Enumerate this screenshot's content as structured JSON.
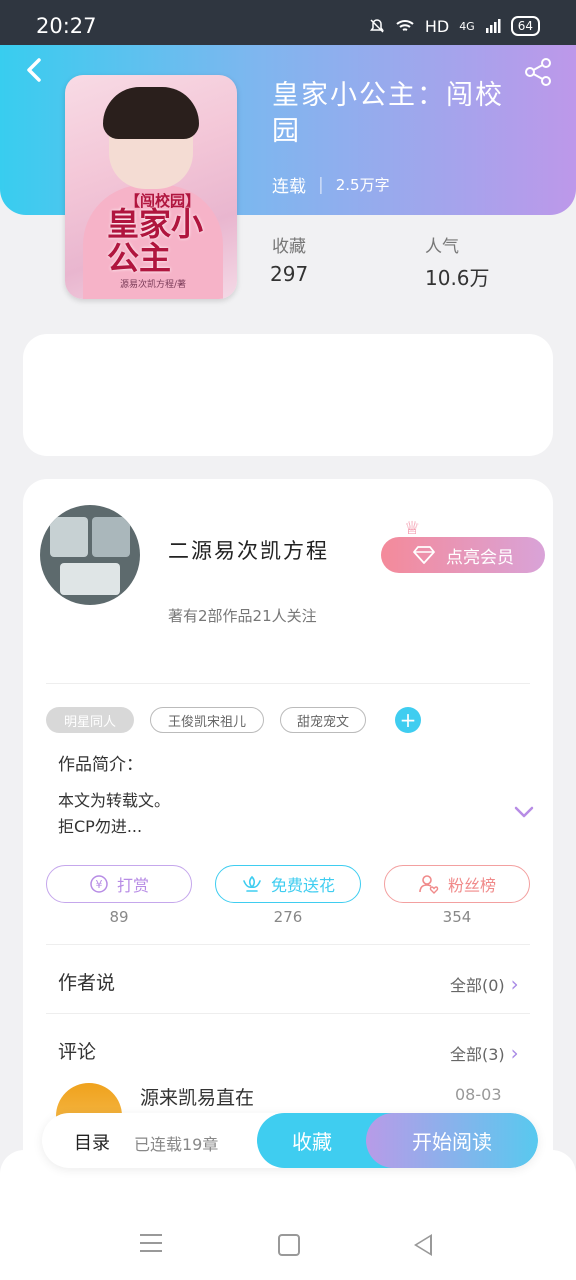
{
  "status_bar": {
    "time": "20:27",
    "network": "HD",
    "signal": "4G",
    "battery": "64"
  },
  "book": {
    "title": "皇家小公主：闯校园",
    "status": "连载",
    "word_count": "2.5万字",
    "cover": {
      "small_title": "【闯校园】",
      "big_title": "皇家小公主",
      "author": "源易次凯方程/著"
    }
  },
  "stats": [
    {
      "label": "收藏",
      "value": "297"
    },
    {
      "label": "人气",
      "value": "10.6万"
    }
  ],
  "author": {
    "name": "二源易次凯方程",
    "subtitle": "著有2部作品21人关注",
    "vip_button": "点亮会员"
  },
  "tags": [
    "明星同人",
    "王俊凯宋祖儿",
    "甜宠宠文"
  ],
  "intro": {
    "label": "作品简介：",
    "line1": "本文为转载文。",
    "line2": "拒CP勿进..."
  },
  "actions": [
    {
      "label": "打赏",
      "count": "89",
      "icon": "yen-icon",
      "color": "#b78ce5"
    },
    {
      "label": "免费送花",
      "count": "276",
      "icon": "flower-icon",
      "color": "#3fcdf0"
    },
    {
      "label": "粉丝榜",
      "count": "354",
      "icon": "fan-icon",
      "color": "#f08a8a"
    }
  ],
  "sections": {
    "author_says": {
      "title": "作者说",
      "more": "全部(0)"
    },
    "comments": {
      "title": "评论",
      "more": "全部(3)"
    }
  },
  "comment": {
    "name": "源来凯易直在",
    "date": "08-03"
  },
  "bottom_bar": {
    "toc": "目录",
    "toc_status": "已连载19章",
    "favorite": "收藏",
    "start_reading": "开始阅读"
  }
}
